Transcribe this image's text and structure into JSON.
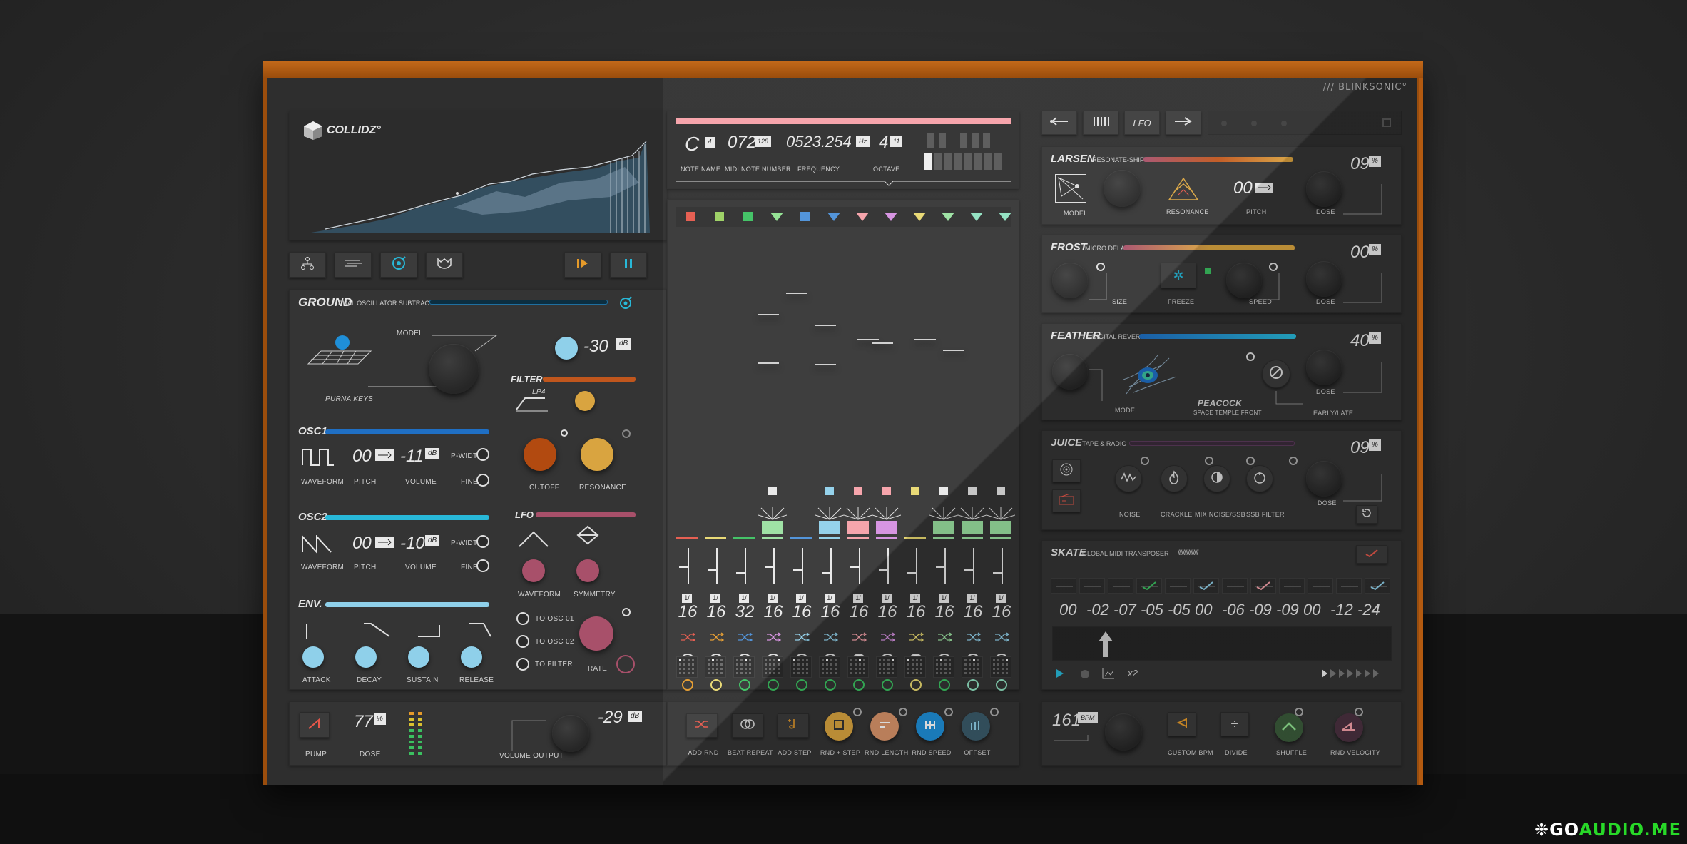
{
  "brand": "/// BLINKSONIC°",
  "logo": {
    "name": "COLLIDZ°"
  },
  "watermark": {
    "prefix": "❉GO",
    "suffix": "AUDIO.ME"
  },
  "colors": {
    "wood": "#b35a10",
    "cyan": "#28b8d8",
    "blue": "#1f6fc4",
    "orange": "#c0561d",
    "gold": "#d9a440",
    "lightblue": "#8fd0ea",
    "maroon": "#a8506a",
    "pink": "#f5a0a8"
  },
  "toolbar_left": {
    "icons": [
      "routing-icon",
      "wind-icon",
      "target-icon",
      "mask-icon"
    ],
    "play_icon": "play-step-icon",
    "pause_icon": "pause-icon"
  },
  "ground": {
    "title": "GROUND",
    "subtitle": "DUAL OSCILLATOR SUBTRACT ENGINE",
    "model_label": "MODEL",
    "model_name": "PURNA KEYS",
    "volume_value": "-30",
    "volume_unit": "dB",
    "osc1": {
      "title": "OSC1",
      "waveform_label": "WAVEFORM",
      "pitch_value": "00",
      "pitch_label": "PITCH",
      "volume_value": "-11",
      "volume_unit": "dB",
      "volume_label": "VOLUME",
      "pwidth_label": "P-WIDTH",
      "fine_label": "FINE"
    },
    "osc2": {
      "title": "OSC2",
      "waveform_label": "WAVEFORM",
      "pitch_value": "00",
      "pitch_label": "PITCH",
      "volume_value": "-10",
      "volume_unit": "dB",
      "volume_label": "VOLUME",
      "pwidth_label": "P-WIDTH",
      "fine_label": "FINE"
    },
    "filter": {
      "title": "FILTER",
      "type": "LP4",
      "cutoff_label": "CUTOFF",
      "resonance_label": "RESONANCE"
    },
    "lfo": {
      "title": "LFO",
      "waveform_label": "WAVEFORM",
      "symmetry_label": "SYMMETRY",
      "to_osc1": "TO OSC 01",
      "to_osc2": "TO OSC 02",
      "to_filter": "TO FILTER",
      "rate_label": "RATE"
    },
    "env": {
      "title": "ENV.",
      "attack": "ATTACK",
      "decay": "DECAY",
      "sustain": "SUSTAIN",
      "release": "RELEASE"
    }
  },
  "pump": {
    "pump_label": "PUMP",
    "dose_value": "77",
    "dose_unit": "%",
    "dose_label": "DOSE",
    "volume_value": "-29",
    "volume_unit": "dB",
    "volume_label": "VOLUME OUTPUT"
  },
  "note_display": {
    "note": "C",
    "note_octave": "4",
    "note_label": "NOTE NAME",
    "midi": "072",
    "midi_max": "128",
    "midi_label": "MIDI NOTE NUMBER",
    "freq": "0523.254",
    "freq_unit": "Hz",
    "freq_label": "FREQUENCY",
    "octave": "4",
    "octave_max": "11",
    "octave_label": "OCTAVE"
  },
  "sequencer": {
    "steps": [
      {
        "num": "16",
        "frac": "1/"
      },
      {
        "num": "16",
        "frac": "1/"
      },
      {
        "num": "32",
        "frac": "1/"
      },
      {
        "num": "16",
        "frac": "1/"
      },
      {
        "num": "16",
        "frac": "1/"
      },
      {
        "num": "16",
        "frac": "1/"
      },
      {
        "num": "16",
        "frac": "1/"
      },
      {
        "num": "16",
        "frac": "1/"
      },
      {
        "num": "16",
        "frac": "1/"
      },
      {
        "num": "16",
        "frac": "1/"
      },
      {
        "num": "16",
        "frac": "1/"
      },
      {
        "num": "16",
        "frac": "1/"
      }
    ]
  },
  "seq_buttons": [
    {
      "label": "ADD RND",
      "icon": "shuffle-icon"
    },
    {
      "label": "BEAT REPEAT",
      "icon": "loop-icon"
    },
    {
      "label": "ADD STEP",
      "icon": "note-plus-icon"
    },
    {
      "label": "RND + STEP",
      "icon": "square-icon"
    },
    {
      "label": "RND LENGTH",
      "icon": "length-icon"
    },
    {
      "label": "RND SPEED",
      "icon": "speed-icon"
    },
    {
      "label": "OFFSET",
      "icon": "bars-icon"
    }
  ],
  "right_toolbar": {
    "icons": [
      "arrow-left-icon",
      "keys-icon",
      "lfo-icon",
      "arrow-right-icon"
    ],
    "lfo_label": "LFO"
  },
  "larsen": {
    "title": "LARSEN",
    "subtitle": "RESONATE-SHIFTER",
    "model_label": "MODEL",
    "resonance_label": "RESONANCE",
    "pitch_value": "00",
    "pitch_label": "PITCH",
    "dose_value": "09",
    "dose_unit": "%",
    "dose_label": "DOSE"
  },
  "frost": {
    "title": "FROST",
    "subtitle": "MICRO DELAY",
    "size_label": "SIZE",
    "freeze_label": "FREEZE",
    "speed_label": "SPEED",
    "dose_value": "00",
    "dose_unit": "%",
    "dose_label": "DOSE"
  },
  "feather": {
    "title": "FEATHER",
    "subtitle": "DIGITAL REVERB",
    "model_label": "MODEL",
    "preset_name": "PEACOCK",
    "preset_desc": "SPACE TEMPLE FRONT",
    "early_late_label": "EARLY/LATE",
    "dose_value": "40",
    "dose_unit": "%",
    "dose_label": "DOSE"
  },
  "juice": {
    "title": "JUICE",
    "subtitle": "TAPE & RADIO",
    "noise_label": "NOISE",
    "crackle_label": "CRACKLE",
    "mix_label": "MIX NOISE/SSB",
    "ssb_label": "SSB FILTER",
    "dose_value": "09",
    "dose_unit": "%",
    "dose_label": "DOSE"
  },
  "skate": {
    "title": "SKATE",
    "subtitle": "GLOBAL MIDI TRANSPOSER",
    "hatch": "////////////////",
    "values": [
      "00",
      "-02",
      "-07",
      "-05",
      "-05",
      "00",
      "-06",
      "-09",
      "-09",
      "00",
      "-12",
      "-24"
    ],
    "multiplier": "x2"
  },
  "tempo": {
    "bpm_value": "161",
    "bpm_unit": "BPM",
    "custom_label": "CUSTOM BPM",
    "divide_label": "DIVIDE",
    "shuffle_label": "SHUFFLE",
    "rnd_velocity_label": "RND VELOCITY"
  }
}
